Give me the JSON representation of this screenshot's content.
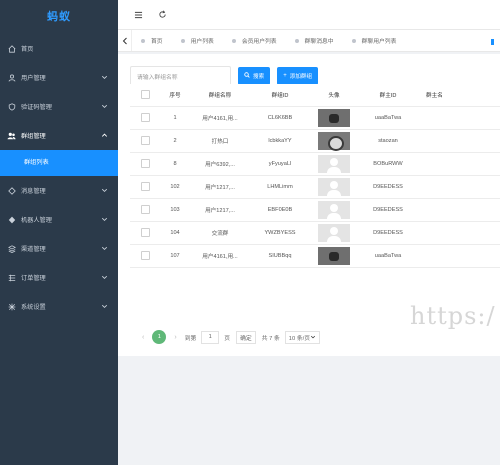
{
  "app": {
    "logo": "蚂蚁"
  },
  "sidebar": {
    "items": [
      {
        "label": "首页",
        "icon": "home-icon"
      },
      {
        "label": "用户管理",
        "icon": "user-icon"
      },
      {
        "label": "验证码管理",
        "icon": "shield-icon"
      },
      {
        "label": "群组管理",
        "icon": "group-icon",
        "open": true
      },
      {
        "label": "消息管理",
        "icon": "message-icon"
      },
      {
        "label": "机器人管理",
        "icon": "robot-icon"
      },
      {
        "label": "渠道管理",
        "icon": "channel-icon"
      },
      {
        "label": "订单管理",
        "icon": "order-icon"
      },
      {
        "label": "系统设置",
        "icon": "settings-icon"
      }
    ],
    "submenu": {
      "label": "群组列表"
    }
  },
  "tabs": [
    {
      "label": "首页"
    },
    {
      "label": "用户列表"
    },
    {
      "label": "会员用户列表"
    },
    {
      "label": "群聊消息中"
    },
    {
      "label": "群聊用户列表"
    }
  ],
  "search": {
    "placeholder": "请输入群组名称",
    "search_label": "搜索",
    "add_label": "添加群组"
  },
  "table": {
    "columns": [
      "",
      "序号",
      "群组名称",
      "群组ID",
      "头像",
      "群主ID",
      "群主名"
    ],
    "rows": [
      {
        "idx": "1",
        "name": "用户4161,用...",
        "gid": "CL6K6BB",
        "avatar": "photo",
        "owner": "uaaBaTwa"
      },
      {
        "idx": "2",
        "name": "打热口",
        "gid": "lcbkkaYY",
        "avatar": "photo2",
        "owner": "staozan"
      },
      {
        "idx": "8",
        "name": "用户6392,...",
        "gid": "yFyuyaLl",
        "avatar": "default",
        "owner": "BOBuRWW"
      },
      {
        "idx": "102",
        "name": "用户1217,...",
        "gid": "LHMLimm",
        "avatar": "default",
        "owner": "D9EEDESS"
      },
      {
        "idx": "103",
        "name": "用户1217,...",
        "gid": "EBF0E0B",
        "avatar": "default",
        "owner": "D9EEDESS"
      },
      {
        "idx": "104",
        "name": "交流群",
        "gid": "YWZBYESS",
        "avatar": "default",
        "owner": "D9EEDESS"
      },
      {
        "idx": "107",
        "name": "用户4161,用...",
        "gid": "SIUBBqq",
        "avatar": "photo",
        "owner": "uaaBaTwa"
      }
    ]
  },
  "pager": {
    "prev": "‹",
    "current": "1",
    "next": "›",
    "goto_label": "到第",
    "page_input": "1",
    "page_unit": "页",
    "confirm_label": "确定",
    "total_label": "共 7 条",
    "page_size": "10 条/页"
  },
  "watermark": "https:/"
}
